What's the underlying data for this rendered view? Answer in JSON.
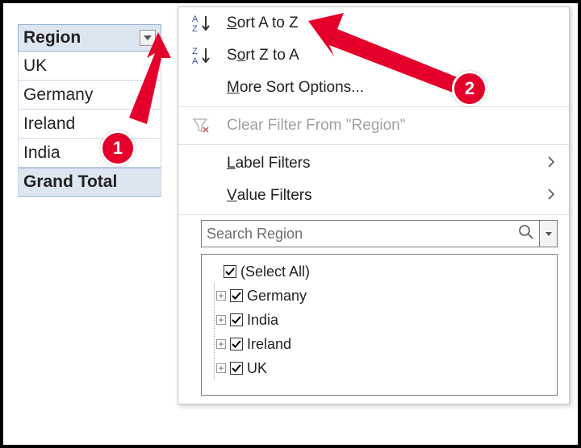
{
  "pivot": {
    "header_label": "Region",
    "rows": [
      "UK",
      "Germany",
      "Ireland",
      "India"
    ],
    "total_label": "Grand Total"
  },
  "menu": {
    "sort_az": "Sort A to Z",
    "sort_za": "Sort Z to A",
    "more_sort": "More Sort Options...",
    "clear_filter": "Clear Filter From \"Region\"",
    "label_filters": "Label Filters",
    "value_filters": "Value Filters",
    "search_placeholder": "Search Region",
    "select_all": "(Select All)",
    "items": [
      "Germany",
      "India",
      "Ireland",
      "UK"
    ]
  },
  "annotations": {
    "badge1": "1",
    "badge2": "2"
  },
  "colors": {
    "annotation_red": "#e4002b",
    "header_blue": "#dce6f1"
  }
}
